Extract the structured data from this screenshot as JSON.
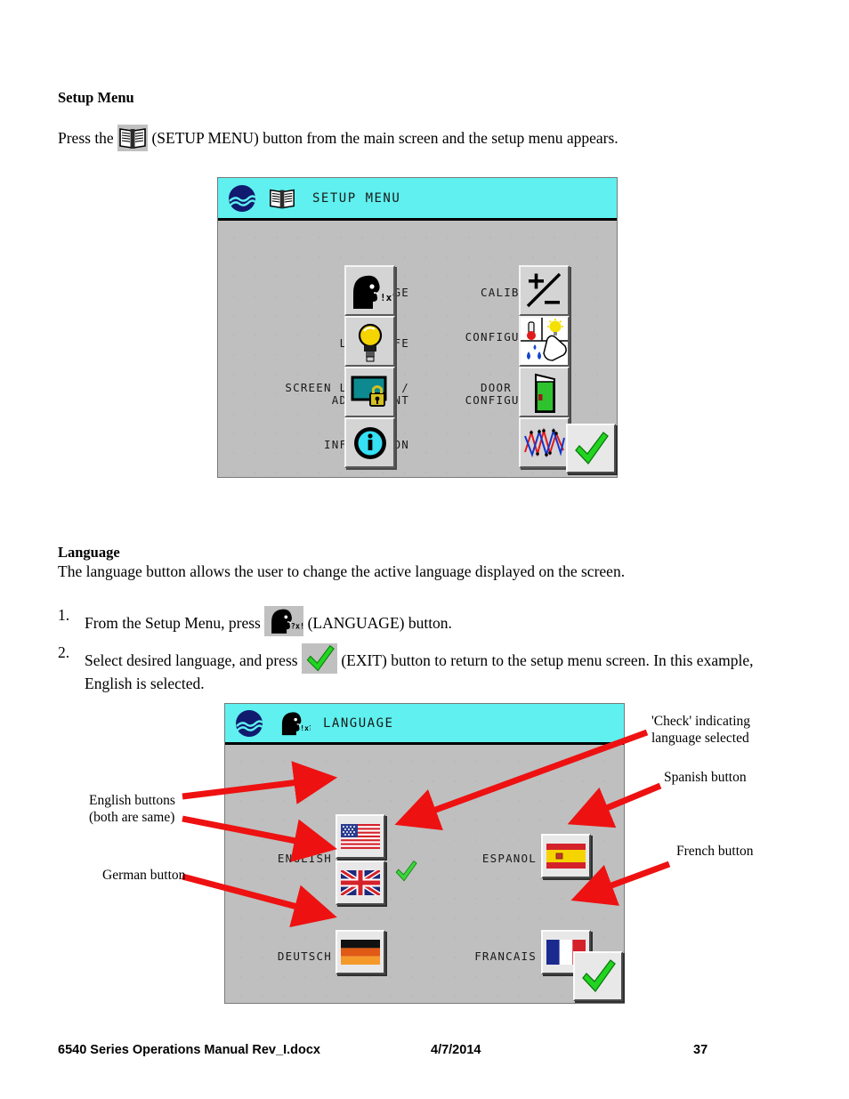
{
  "document": {
    "section1": {
      "heading": "Setup Menu",
      "body_before": "Press the ",
      "body_after": " (SETUP MENU) button from the main screen and the setup menu appears."
    },
    "section2": {
      "heading": "Language",
      "intro": "The language button allows the user to change the active language displayed on the screen.",
      "steps": [
        {
          "number": "1.",
          "before": "From the Setup Menu, press ",
          "after": " (LANGUAGE) button."
        },
        {
          "number": "2.",
          "before": "Select desired language, and press ",
          "after": " (EXIT) button to return to the setup menu screen.  In this example, English is selected."
        }
      ]
    }
  },
  "setup_menu_screen": {
    "title": "SETUP MENU",
    "title_icon": "open-book-icon",
    "logo": "wave-logo-icon",
    "title_bar_color": "#5ff0ef",
    "body_color": "#bfbfbf",
    "left_column": [
      {
        "label": "LANGUAGE",
        "icon": "talking-head-icon"
      },
      {
        "label": "LAMP LIFE",
        "icon": "lightbulb-icon"
      },
      {
        "label": "SCREEN LOCKOUT /\nADJUSTMENT",
        "icon": "screen-lock-icon"
      },
      {
        "label": "INFORMATION",
        "icon": "info-circle-icon"
      }
    ],
    "right_column": [
      {
        "label": "CALIBRATION",
        "icon": "plus-minus-icon"
      },
      {
        "label": "CONFIGURATION\nMENU",
        "icon": "configuration-hand-icon"
      },
      {
        "label": "DOOR SWITCH\nCONFIGURATION",
        "icon": "green-door-icon"
      },
      {
        "label": "GRAPH",
        "icon": "zigzag-graph-icon"
      }
    ],
    "exit_button": {
      "icon": "green-check-icon",
      "label": ""
    }
  },
  "language_screen": {
    "title": "LANGUAGE",
    "title_icon": "talking-head-icon",
    "logo": "wave-logo-icon",
    "title_bar_color": "#5ff0ef",
    "body_color": "#bfbfbf",
    "options": [
      {
        "label": "ENGLISH",
        "icon": "us-flag-icon",
        "selected": true
      },
      {
        "label": "",
        "icon": "uk-flag-icon",
        "selected": false
      },
      {
        "label": "ESPANOL",
        "icon": "spain-flag-icon",
        "selected": false
      },
      {
        "label": "DEUTSCH",
        "icon": "germany-flag-icon",
        "selected": false
      },
      {
        "label": "FRANCAIS",
        "icon": "france-flag-icon",
        "selected": false
      }
    ],
    "selected_check": "green-check-icon",
    "exit_button": {
      "icon": "green-check-icon"
    }
  },
  "annotations": {
    "arrow_color": "#ee1111",
    "items": [
      {
        "name": "check-callout",
        "text": "'Check' indicating\nlanguage selected"
      },
      {
        "name": "spanish-callout",
        "text": "Spanish button"
      },
      {
        "name": "french-callout",
        "text": "French button"
      },
      {
        "name": "english-callout",
        "text": "English buttons\n(both are same)"
      },
      {
        "name": "german-callout",
        "text": "German button"
      }
    ]
  },
  "footer": {
    "left": "6540 Series Operations Manual Rev_I.docx",
    "center": "4/7/2014",
    "right": "37"
  }
}
